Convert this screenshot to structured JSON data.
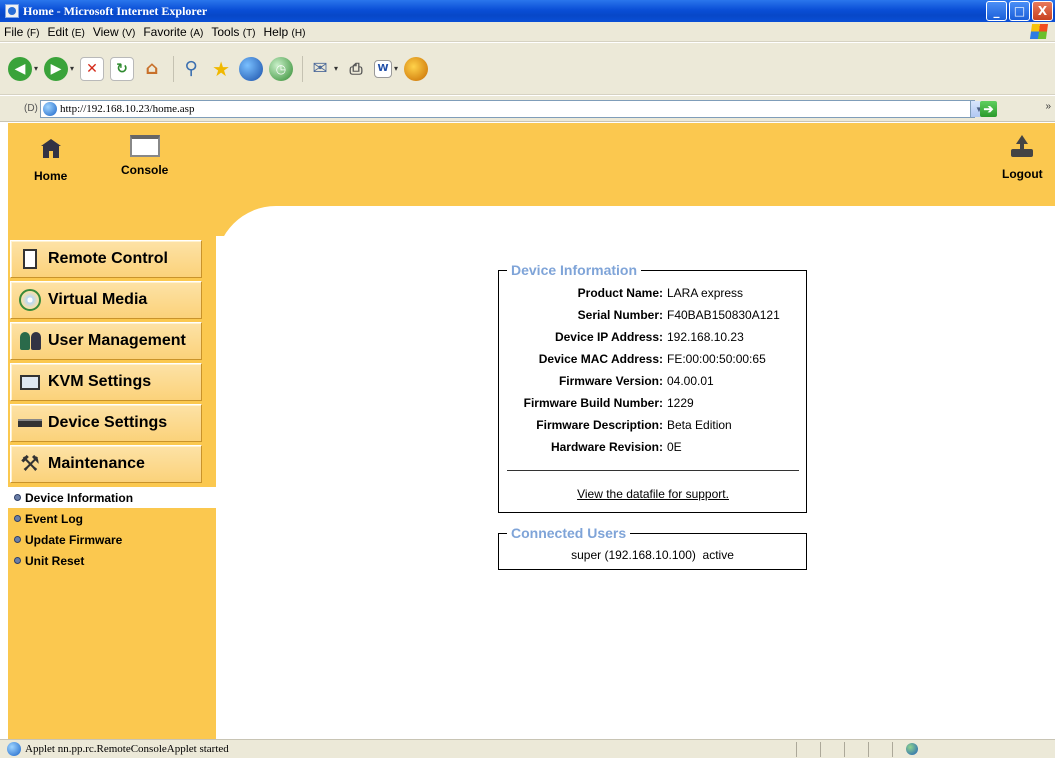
{
  "window": {
    "title": "Home - Microsoft Internet Explorer",
    "buttons": {
      "minimize": "_",
      "maximize": "□",
      "close": "X"
    }
  },
  "menubar": [
    {
      "label": "File",
      "accel": "(F)"
    },
    {
      "label": "Edit",
      "accel": "(E)"
    },
    {
      "label": "View",
      "accel": "(V)"
    },
    {
      "label": "Favorite",
      "accel": "(A)"
    },
    {
      "label": "Tools",
      "accel": "(T)"
    },
    {
      "label": "Help",
      "accel": "(H)"
    }
  ],
  "toolbar": {
    "icons": [
      "back-icon",
      "forward-icon",
      "stop-icon",
      "refresh-icon",
      "home-icon",
      "search-icon",
      "favorites-icon",
      "media-icon",
      "history-icon",
      "mail-icon",
      "print-icon",
      "edit-icon",
      "messenger-icon"
    ]
  },
  "address": {
    "label": "(D)",
    "url": "http://192.168.10.23/home.asp",
    "more": "»"
  },
  "topnav": {
    "home": "Home",
    "console": "Console",
    "logout": "Logout"
  },
  "sidebar": {
    "buttons": [
      {
        "id": "remote-control",
        "label": "Remote Control",
        "icon": "remote-control-icon"
      },
      {
        "id": "virtual-media",
        "label": "Virtual Media",
        "icon": "virtual-media-icon"
      },
      {
        "id": "user-management",
        "label": "User Management",
        "icon": "user-management-icon"
      },
      {
        "id": "kvm-settings",
        "label": "KVM Settings",
        "icon": "kvm-settings-icon"
      },
      {
        "id": "device-settings",
        "label": "Device Settings",
        "icon": "device-settings-icon"
      },
      {
        "id": "maintenance",
        "label": "Maintenance",
        "icon": "maintenance-icon"
      }
    ],
    "subitems": [
      {
        "label": "Device Information",
        "active": true
      },
      {
        "label": "Event Log",
        "active": false
      },
      {
        "label": "Update Firmware",
        "active": false
      },
      {
        "label": "Unit Reset",
        "active": false
      }
    ]
  },
  "device_info": {
    "legend": "Device Information",
    "rows": [
      {
        "key": "Product Name:",
        "value": "LARA express"
      },
      {
        "key": "Serial Number:",
        "value": "F40BAB150830A121"
      },
      {
        "key": "Device IP Address:",
        "value": "192.168.10.23"
      },
      {
        "key": "Device MAC Address:",
        "value": "FE:00:00:50:00:65"
      },
      {
        "key": "Firmware Version:",
        "value": "04.00.01"
      },
      {
        "key": "Firmware Build Number:",
        "value": "1229"
      },
      {
        "key": "Firmware Description:",
        "value": "Beta Edition"
      },
      {
        "key": "Hardware Revision:",
        "value": "0E"
      }
    ],
    "support_link": "View the datafile for support."
  },
  "connected_users": {
    "legend": "Connected Users",
    "entry": "super (192.168.10.100)  active"
  },
  "statusbar": {
    "text": "Applet nn.pp.rc.RemoteConsoleApplet started"
  },
  "colors": {
    "accent": "#fbc84f",
    "legend": "#7fa4d8"
  }
}
